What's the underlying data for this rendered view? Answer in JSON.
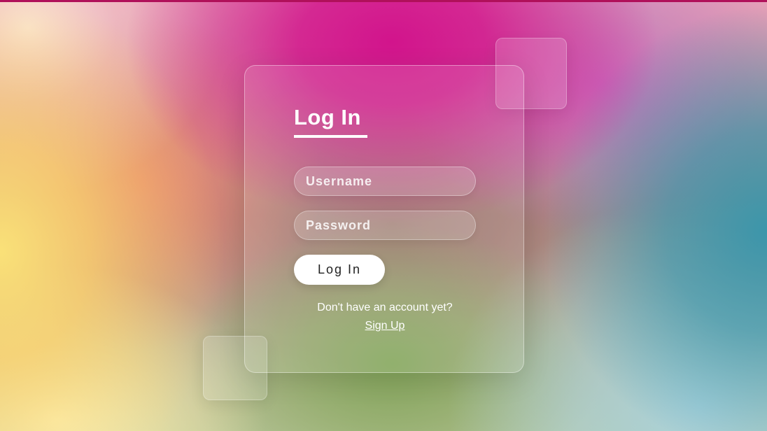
{
  "login": {
    "title": "Log In",
    "username_placeholder": "Username",
    "password_placeholder": "Password",
    "submit_label": "Log In",
    "signup_prompt": "Don't have an account yet?",
    "signup_link": "Sign Up"
  },
  "colors": {
    "top_strip": "#b0105a",
    "button_background": "#ffffff",
    "text": "#ffffff"
  }
}
